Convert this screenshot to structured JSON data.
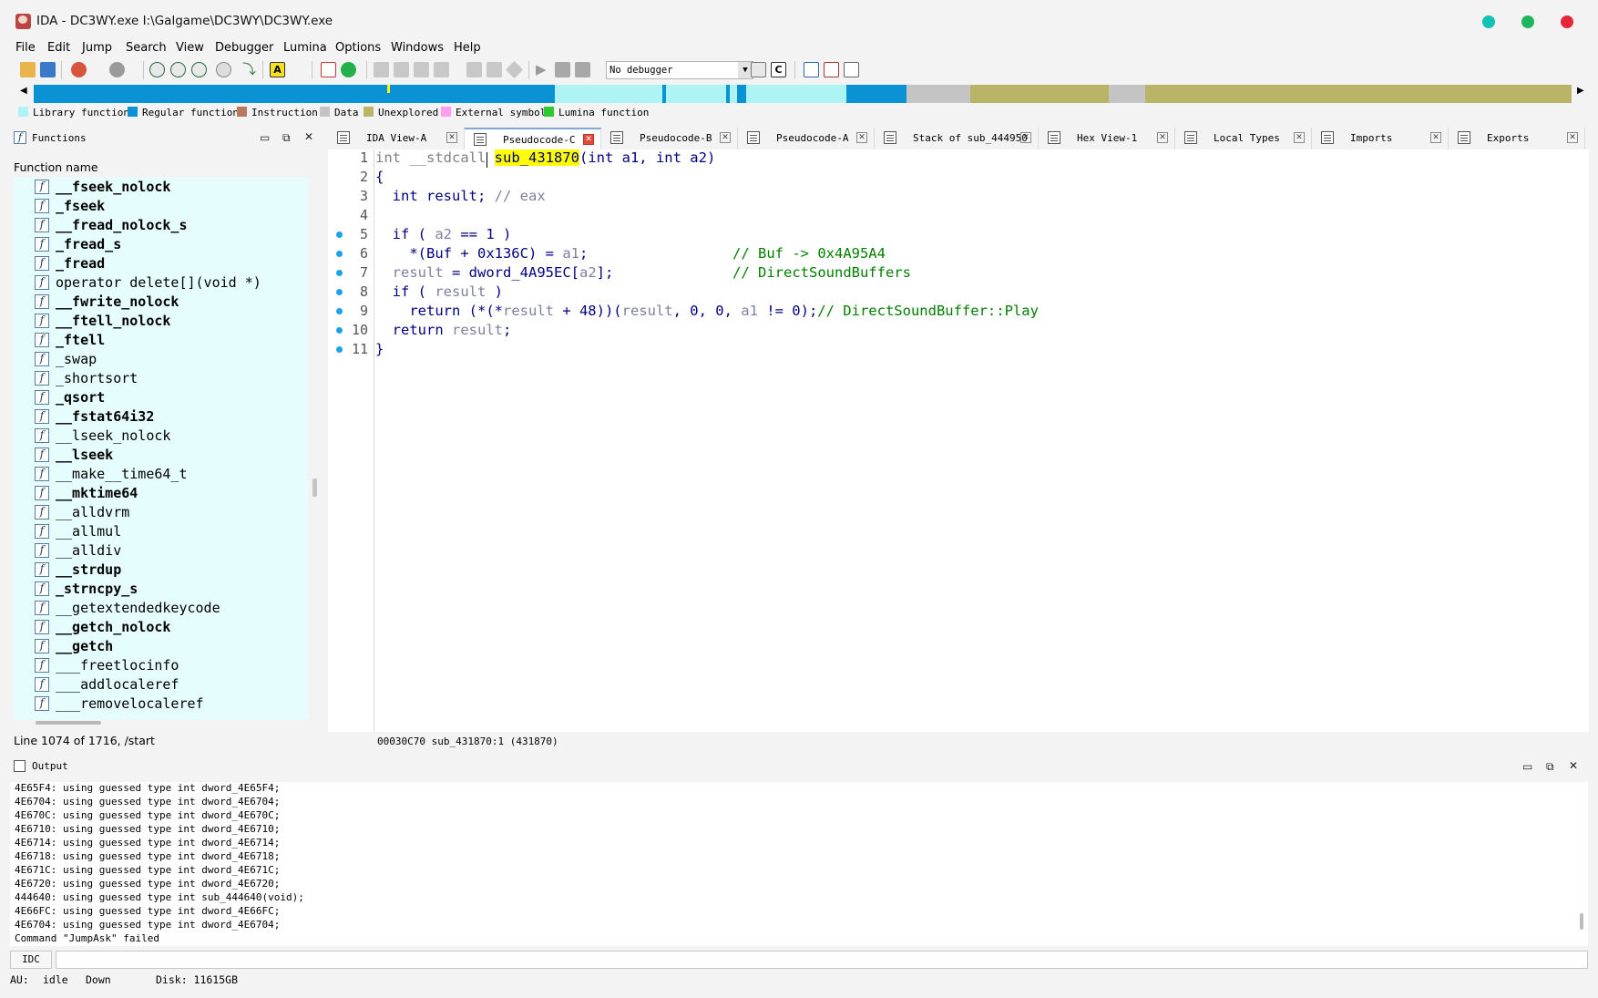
{
  "window": {
    "title": "IDA - DC3WY.exe I:\\Galgame\\DC3WY\\DC3WY.exe"
  },
  "menu": [
    "File",
    "Edit",
    "Jump",
    "Search",
    "View",
    "Debugger",
    "Lumina",
    "Options",
    "Windows",
    "Help"
  ],
  "toolbar": {
    "debugger_select": "No debugger"
  },
  "legend": [
    "Library function",
    "Regular function",
    "Instruction",
    "Data",
    "Unexplored",
    "External symbol",
    "Lumina function"
  ],
  "functions_pane": {
    "title": "Functions",
    "column_header": "Function name",
    "items": [
      {
        "name": "__fseek_nolock",
        "bold": true
      },
      {
        "name": "_fseek",
        "bold": true
      },
      {
        "name": "__fread_nolock_s",
        "bold": true
      },
      {
        "name": "_fread_s",
        "bold": true
      },
      {
        "name": "_fread",
        "bold": true
      },
      {
        "name": "operator delete[](void *)",
        "bold": false
      },
      {
        "name": "__fwrite_nolock",
        "bold": true
      },
      {
        "name": "__ftell_nolock",
        "bold": true
      },
      {
        "name": "_ftell",
        "bold": true
      },
      {
        "name": "_swap",
        "bold": false
      },
      {
        "name": "_shortsort",
        "bold": false
      },
      {
        "name": "_qsort",
        "bold": true
      },
      {
        "name": "__fstat64i32",
        "bold": true
      },
      {
        "name": "__lseek_nolock",
        "bold": false
      },
      {
        "name": "__lseek",
        "bold": true
      },
      {
        "name": "__make__time64_t",
        "bold": false
      },
      {
        "name": "__mktime64",
        "bold": true
      },
      {
        "name": "__alldvrm",
        "bold": false
      },
      {
        "name": "__allmul",
        "bold": false
      },
      {
        "name": "__alldiv",
        "bold": false
      },
      {
        "name": "__strdup",
        "bold": true
      },
      {
        "name": "_strncpy_s",
        "bold": true
      },
      {
        "name": "__getextendedkeycode",
        "bold": false
      },
      {
        "name": "__getch_nolock",
        "bold": true
      },
      {
        "name": "__getch",
        "bold": true
      },
      {
        "name": "___freetlocinfo",
        "bold": false
      },
      {
        "name": "___addlocaleref",
        "bold": false
      },
      {
        "name": "___removelocaleref",
        "bold": false
      }
    ],
    "status": "Line 1074 of 1716, /start"
  },
  "tabs": [
    {
      "label": "IDA View-A",
      "active": false
    },
    {
      "label": "Pseudocode-C",
      "active": true
    },
    {
      "label": "Pseudocode-B",
      "active": false
    },
    {
      "label": "Pseudocode-A",
      "active": false
    },
    {
      "label": "Stack of sub_444950",
      "active": false
    },
    {
      "label": "Hex View-1",
      "active": false
    },
    {
      "label": "Local Types",
      "active": false
    },
    {
      "label": "Imports",
      "active": false
    },
    {
      "label": "Exports",
      "active": false
    }
  ],
  "code": {
    "line_numbers": [
      "1",
      "2",
      "3",
      "4",
      "5",
      "6",
      "7",
      "8",
      "9",
      "10",
      "11"
    ],
    "l1_a": "int __stdcall ",
    "l1_hl": "sub_431870",
    "l1_b": "(int a1, int a2)",
    "l2": "{",
    "l3_a": "  int result; ",
    "l3_c": "// eax",
    "l5_a": "  if ( ",
    "l5_b": "a2",
    "l5_c": " == 1 )",
    "l6_a": "    *(Buf + 0x136C) = ",
    "l6_b": "a1",
    "l6_c": ";",
    "l6_cm": "// Buf -> 0x4A95A4",
    "l7_a": "  ",
    "l7_b": "result",
    "l7_c": " = dword_4A95EC[",
    "l7_d": "a2",
    "l7_e": "];",
    "l7_cm": "// DirectSoundBuffers",
    "l8_a": "  if ( ",
    "l8_b": "result",
    "l8_c": " )",
    "l9_a": "    return (*(*",
    "l9_b": "result",
    "l9_c": " + 48))(",
    "l9_d": "result",
    "l9_e": ", 0, 0, ",
    "l9_f": "a1",
    "l9_g": " != 0);",
    "l9_cm": "// DirectSoundBuffer::Play",
    "l10_a": "  return ",
    "l10_b": "result",
    "l10_c": ";",
    "l11": "}"
  },
  "editor_status": "00030C70 sub_431870:1 (431870)",
  "output": {
    "title": "Output",
    "lines": [
      "4E65F4: using guessed type int dword_4E65F4;",
      "4E6704: using guessed type int dword_4E6704;",
      "4E670C: using guessed type int dword_4E670C;",
      "4E6710: using guessed type int dword_4E6710;",
      "4E6714: using guessed type int dword_4E6714;",
      "4E6718: using guessed type int dword_4E6718;",
      "4E671C: using guessed type int dword_4E671C;",
      "4E6720: using guessed type int dword_4E6720;",
      "444640: using guessed type int sub_444640(void);",
      "4E66FC: using guessed type int dword_4E66FC;",
      "4E6704: using guessed type int dword_4E6704;",
      "Command \"JumpAsk\" failed"
    ]
  },
  "command": {
    "language": "IDC",
    "value": ""
  },
  "status": {
    "au_label": "AU:",
    "au_state": "idle",
    "direction": "Down",
    "disk": "Disk: 11615GB"
  },
  "colors": {
    "library_function": "#aef4f4",
    "regular_function": "#0b92d5",
    "instruction": "#b87a5a",
    "data": "#c4c4c4",
    "unexplored": "#b9b466",
    "external_symbol": "#ff9cf1",
    "lumina_function": "#30c830",
    "keyword": "#000080",
    "comment": "#008000",
    "variable": "#8080a0",
    "highlight": "#ffff00",
    "breakpoint": "#1aa4e8"
  }
}
